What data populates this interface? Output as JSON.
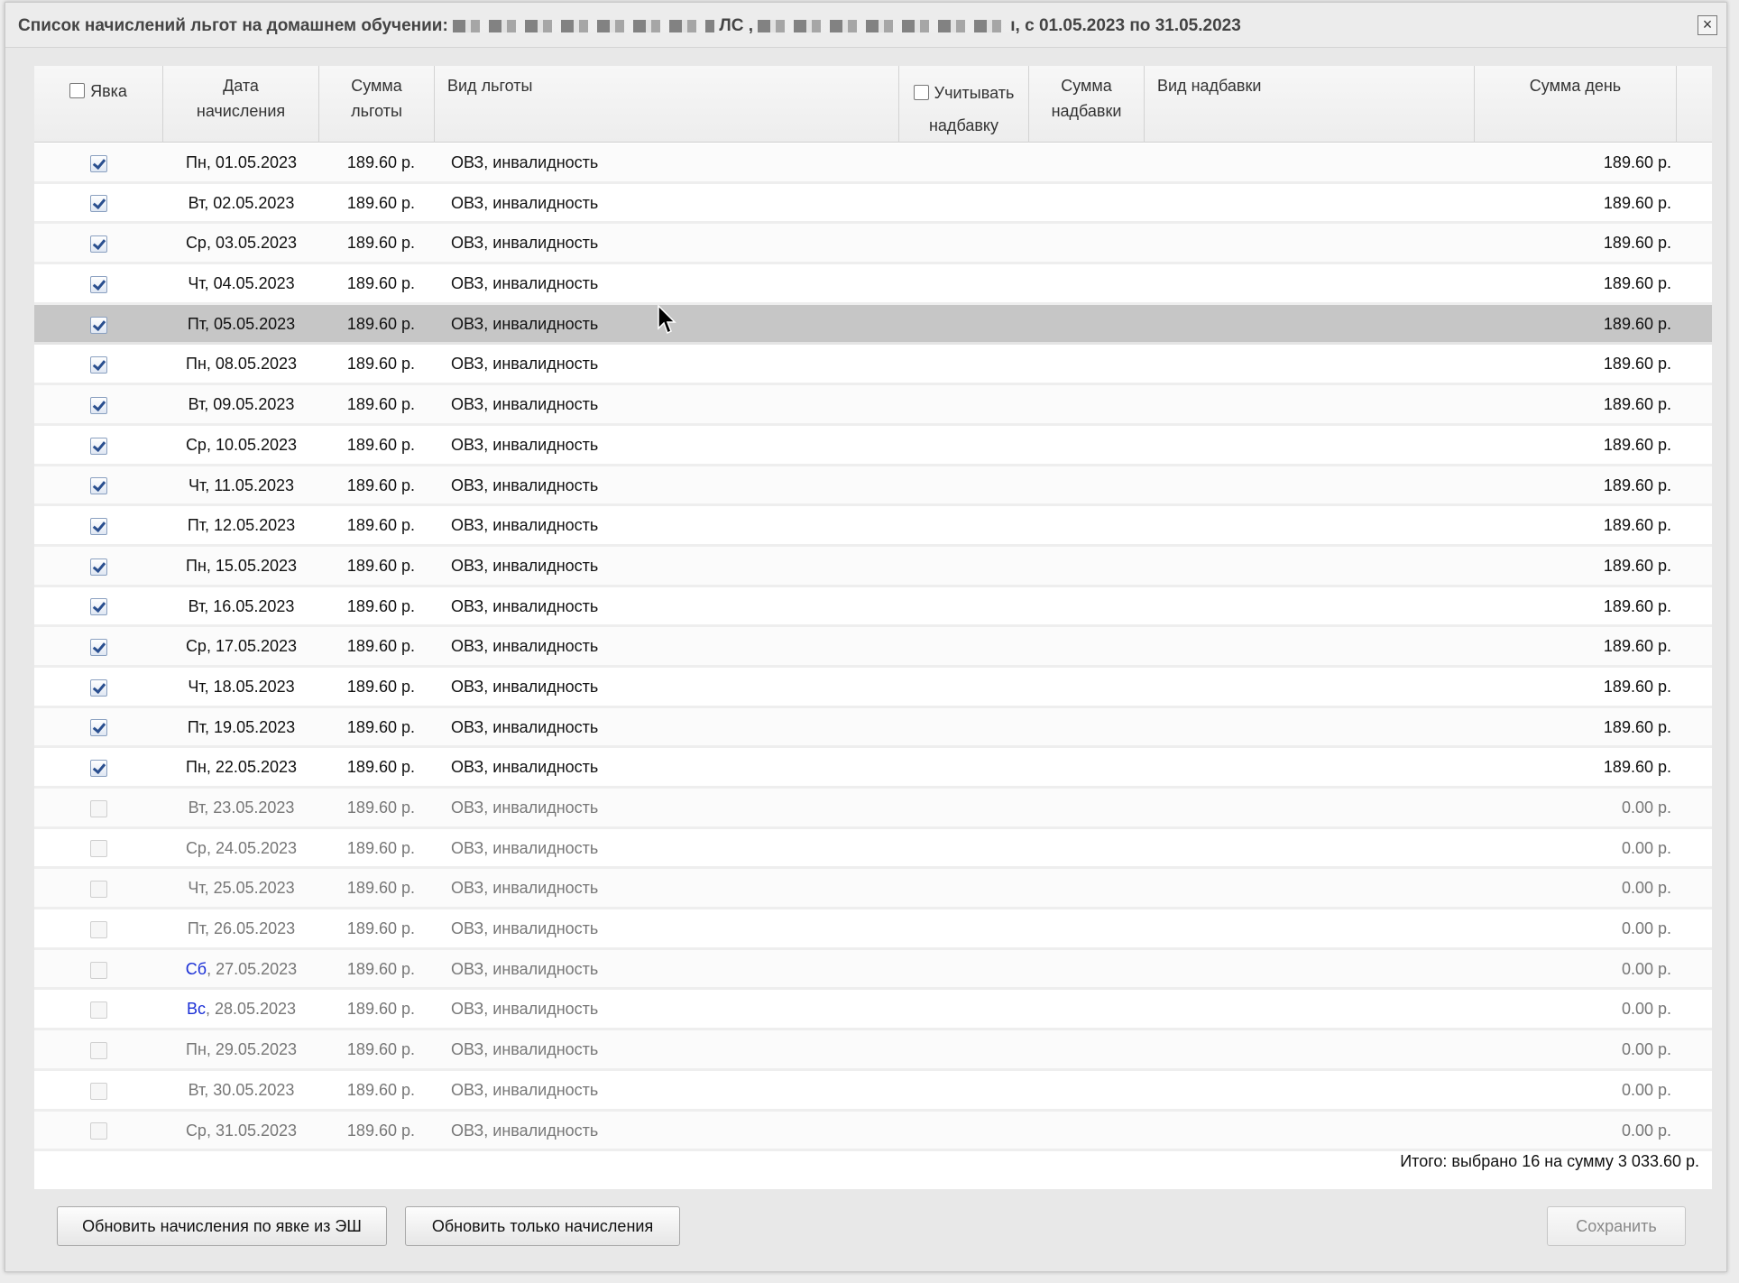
{
  "dialog": {
    "title_prefix": "Список начислений льгот на домашнем обучении:",
    "title_mid": "ЛС ,",
    "title_suffix": "ı, с 01.05.2023 по 31.05.2023",
    "close_label": "×"
  },
  "header": {
    "attendance": "Явка",
    "date_line1": "Дата",
    "date_line2": "начисления",
    "sum_line1": "Сумма",
    "sum_line2": "льготы",
    "benefit_type": "Вид льготы",
    "include_line1": "Учитывать",
    "include_line2": "надбавку",
    "bonus_sum_line1": "Сумма",
    "bonus_sum_line2": "надбавки",
    "bonus_type": "Вид надбавки",
    "day_sum": "Сумма день"
  },
  "rows": [
    {
      "checked": true,
      "dow": "Пн",
      "date": "01.05.2023",
      "sum": "189.60 р.",
      "type": "ОВЗ, инвалидность",
      "day": "189.60 р."
    },
    {
      "checked": true,
      "dow": "Вт",
      "date": "02.05.2023",
      "sum": "189.60 р.",
      "type": "ОВЗ, инвалидность",
      "day": "189.60 р."
    },
    {
      "checked": true,
      "dow": "Ср",
      "date": "03.05.2023",
      "sum": "189.60 р.",
      "type": "ОВЗ, инвалидность",
      "day": "189.60 р."
    },
    {
      "checked": true,
      "dow": "Чт",
      "date": "04.05.2023",
      "sum": "189.60 р.",
      "type": "ОВЗ, инвалидность",
      "day": "189.60 р."
    },
    {
      "checked": true,
      "dow": "Пт",
      "date": "05.05.2023",
      "sum": "189.60 р.",
      "type": "ОВЗ, инвалидность",
      "day": "189.60 р.",
      "selected": true
    },
    {
      "checked": true,
      "dow": "Пн",
      "date": "08.05.2023",
      "sum": "189.60 р.",
      "type": "ОВЗ, инвалидность",
      "day": "189.60 р."
    },
    {
      "checked": true,
      "dow": "Вт",
      "date": "09.05.2023",
      "sum": "189.60 р.",
      "type": "ОВЗ, инвалидность",
      "day": "189.60 р."
    },
    {
      "checked": true,
      "dow": "Ср",
      "date": "10.05.2023",
      "sum": "189.60 р.",
      "type": "ОВЗ, инвалидность",
      "day": "189.60 р."
    },
    {
      "checked": true,
      "dow": "Чт",
      "date": "11.05.2023",
      "sum": "189.60 р.",
      "type": "ОВЗ, инвалидность",
      "day": "189.60 р."
    },
    {
      "checked": true,
      "dow": "Пт",
      "date": "12.05.2023",
      "sum": "189.60 р.",
      "type": "ОВЗ, инвалидность",
      "day": "189.60 р."
    },
    {
      "checked": true,
      "dow": "Пн",
      "date": "15.05.2023",
      "sum": "189.60 р.",
      "type": "ОВЗ, инвалидность",
      "day": "189.60 р."
    },
    {
      "checked": true,
      "dow": "Вт",
      "date": "16.05.2023",
      "sum": "189.60 р.",
      "type": "ОВЗ, инвалидность",
      "day": "189.60 р."
    },
    {
      "checked": true,
      "dow": "Ср",
      "date": "17.05.2023",
      "sum": "189.60 р.",
      "type": "ОВЗ, инвалидность",
      "day": "189.60 р."
    },
    {
      "checked": true,
      "dow": "Чт",
      "date": "18.05.2023",
      "sum": "189.60 р.",
      "type": "ОВЗ, инвалидность",
      "day": "189.60 р."
    },
    {
      "checked": true,
      "dow": "Пт",
      "date": "19.05.2023",
      "sum": "189.60 р.",
      "type": "ОВЗ, инвалидность",
      "day": "189.60 р."
    },
    {
      "checked": true,
      "dow": "Пн",
      "date": "22.05.2023",
      "sum": "189.60 р.",
      "type": "ОВЗ, инвалидность",
      "day": "189.60 р."
    },
    {
      "checked": false,
      "dow": "Вт",
      "date": "23.05.2023",
      "sum": "189.60 р.",
      "type": "ОВЗ, инвалидность",
      "day": "0.00 р."
    },
    {
      "checked": false,
      "dow": "Ср",
      "date": "24.05.2023",
      "sum": "189.60 р.",
      "type": "ОВЗ, инвалидность",
      "day": "0.00 р."
    },
    {
      "checked": false,
      "dow": "Чт",
      "date": "25.05.2023",
      "sum": "189.60 р.",
      "type": "ОВЗ, инвалидность",
      "day": "0.00 р."
    },
    {
      "checked": false,
      "dow": "Пт",
      "date": "26.05.2023",
      "sum": "189.60 р.",
      "type": "ОВЗ, инвалидность",
      "day": "0.00 р."
    },
    {
      "checked": false,
      "dow": "Сб",
      "date": "27.05.2023",
      "sum": "189.60 р.",
      "type": "ОВЗ, инвалидность",
      "day": "0.00 р.",
      "weekend": true
    },
    {
      "checked": false,
      "dow": "Вс",
      "date": "28.05.2023",
      "sum": "189.60 р.",
      "type": "ОВЗ, инвалидность",
      "day": "0.00 р.",
      "weekend": true
    },
    {
      "checked": false,
      "dow": "Пн",
      "date": "29.05.2023",
      "sum": "189.60 р.",
      "type": "ОВЗ, инвалидность",
      "day": "0.00 р."
    },
    {
      "checked": false,
      "dow": "Вт",
      "date": "30.05.2023",
      "sum": "189.60 р.",
      "type": "ОВЗ, инвалидность",
      "day": "0.00 р."
    },
    {
      "checked": false,
      "dow": "Ср",
      "date": "31.05.2023",
      "sum": "189.60 р.",
      "type": "ОВЗ, инвалидность",
      "day": "0.00 р."
    }
  ],
  "total": "Итого: выбрано 16 на сумму 3 033.60 р.",
  "buttons": {
    "refresh_attendance": "Обновить начисления по явке из ЭШ",
    "refresh_only": "Обновить только начисления",
    "save": "Сохранить"
  },
  "colors": {
    "weekend": "#1a2fd6",
    "selected_row": "#c6c6c6"
  }
}
